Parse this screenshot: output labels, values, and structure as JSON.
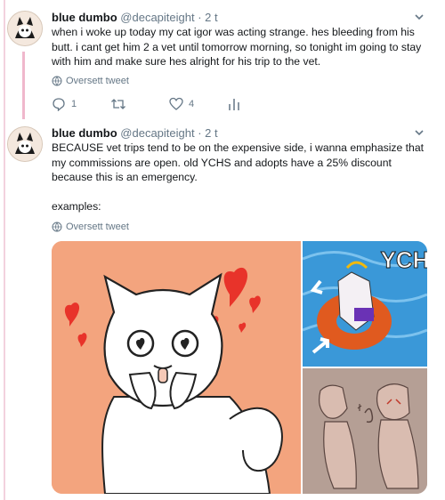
{
  "tweets": [
    {
      "author_name": "blue dumbo",
      "author_handle": "@decapiteight · 2 t",
      "text": "when i woke up today my cat igor was acting strange. hes bleeding from his butt. i cant get him 2 a vet until tomorrow morning, so tonight im going to stay with him and make sure hes alright for his trip to the vet.",
      "translate_label": "Oversett tweet",
      "reply_count": "1",
      "retweet_count": "",
      "like_count": "4"
    },
    {
      "author_name": "blue dumbo",
      "author_handle": "@decapiteight · 2 t",
      "text_lines": [
        "BECAUSE vet trips tend to be on the expensive side, i wanna emphasize that my commissions are open. old YCHS and adopts have a 25% discount because this is an emergency.",
        "examples:"
      ],
      "translate_label": "Oversett tweet",
      "media_text": "YCH"
    }
  ],
  "icons": {
    "chevron": "chevron-down-icon",
    "globe": "globe-icon",
    "reply": "reply-icon",
    "retweet": "retweet-icon",
    "like": "heart-icon",
    "analytics": "analytics-icon"
  },
  "colors": {
    "thread_line": "#f0b8cc",
    "muted": "#657786",
    "media1_bg": "#f3a47e",
    "media2_bg": "#3a98d8",
    "media3_bg": "#b59f95"
  }
}
